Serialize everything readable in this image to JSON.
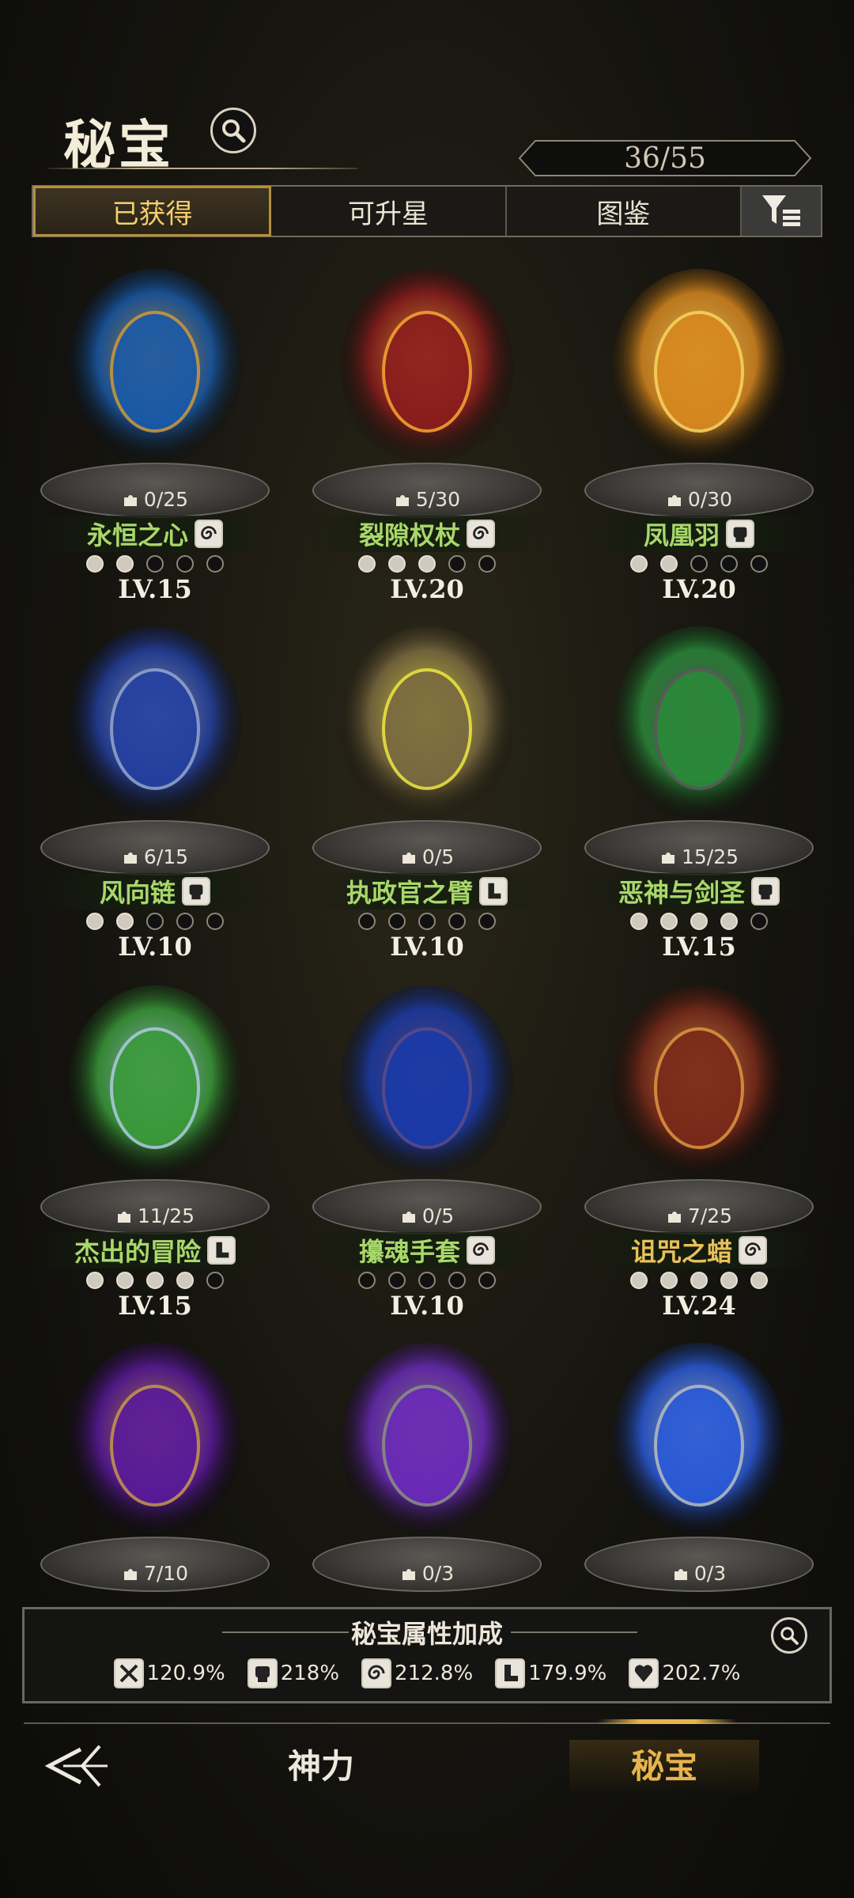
{
  "header": {
    "title": "秘宝",
    "counter": "36/55"
  },
  "tabs": [
    {
      "label": "已获得",
      "active": true
    },
    {
      "label": "可升星",
      "active": false
    },
    {
      "label": "图鉴",
      "active": false
    }
  ],
  "items": [
    {
      "name": "永恒之心",
      "shards": "0/25",
      "level": "LV.15",
      "type_icon": "swirl-icon",
      "name_color": "#a8d86a"
    },
    {
      "name": "裂隙权杖",
      "shards": "5/30",
      "level": "LV.20",
      "type_icon": "swirl-icon",
      "name_color": "#a8d86a"
    },
    {
      "name": "凤凰羽",
      "shards": "0/30",
      "level": "LV.20",
      "type_icon": "fist-icon",
      "name_color": "#a8d86a"
    },
    {
      "name": "风向链",
      "shards": "6/15",
      "level": "LV.10",
      "type_icon": "fist-icon",
      "name_color": "#a8d86a"
    },
    {
      "name": "执政官之臂",
      "shards": "0/5",
      "level": "LV.10",
      "type_icon": "boot-icon",
      "name_color": "#a8d86a"
    },
    {
      "name": "恶神与剑圣",
      "shards": "15/25",
      "level": "LV.15",
      "type_icon": "fist-icon",
      "name_color": "#a8d86a"
    },
    {
      "name": "杰出的冒险",
      "shards": "11/25",
      "level": "LV.15",
      "type_icon": "boot-icon",
      "name_color": "#a8d86a"
    },
    {
      "name": "攥魂手套",
      "shards": "0/5",
      "level": "LV.10",
      "type_icon": "swirl-icon",
      "name_color": "#a8d86a"
    },
    {
      "name": "诅咒之蜡",
      "shards": "7/25",
      "level": "LV.24",
      "type_icon": "swirl-icon",
      "name_color": "#e9c15a"
    },
    {
      "name": "",
      "shards": "7/10",
      "level": "",
      "type_icon": "",
      "name_color": "#a8d86a"
    },
    {
      "name": "",
      "shards": "0/3",
      "level": "",
      "type_icon": "",
      "name_color": "#a8d86a"
    },
    {
      "name": "",
      "shards": "0/3",
      "level": "",
      "type_icon": "",
      "name_color": "#a8d86a"
    }
  ],
  "star_rows": [
    [
      1,
      1,
      0,
      0,
      0
    ],
    [
      1,
      1,
      1,
      0,
      0
    ],
    [
      1,
      1,
      0,
      0,
      0
    ],
    [
      1,
      1,
      0,
      0,
      0
    ],
    [
      0,
      0,
      0,
      0,
      0
    ],
    [
      1,
      1,
      1,
      1,
      0
    ],
    [
      1,
      1,
      1,
      1,
      0
    ],
    [
      0,
      0,
      0,
      0,
      0
    ],
    [
      1,
      1,
      1,
      1,
      1
    ]
  ],
  "bonus": {
    "title": "秘宝属性加成",
    "stats": [
      {
        "icon": "sword-icon",
        "value": "120.9%"
      },
      {
        "icon": "fist-icon",
        "value": "218%"
      },
      {
        "icon": "swirl-icon",
        "value": "212.8%"
      },
      {
        "icon": "boot-icon",
        "value": "179.9%"
      },
      {
        "icon": "heart-icon",
        "value": "202.7%"
      }
    ]
  },
  "nav": {
    "item1": "神力",
    "item2": "秘宝"
  }
}
